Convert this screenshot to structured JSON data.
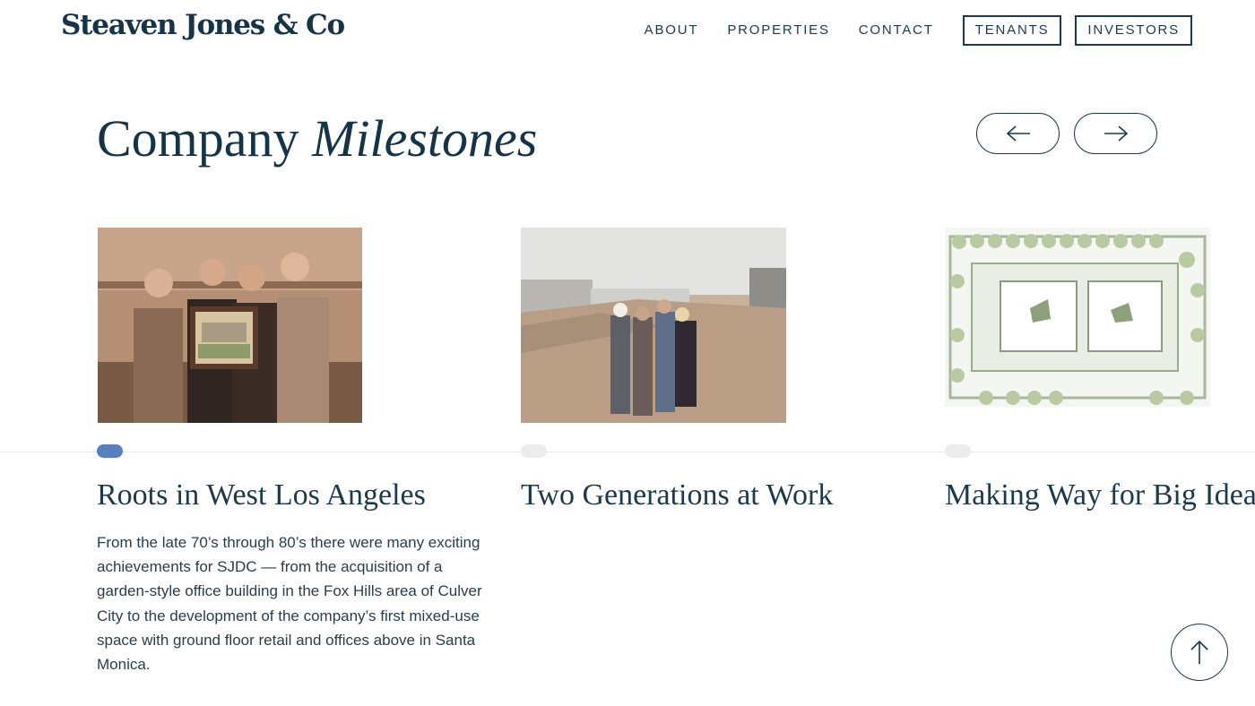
{
  "header": {
    "logo": "Steaven Jones & Co",
    "nav": {
      "about": "ABOUT",
      "properties": "PROPERTIES",
      "contact": "CONTACT"
    },
    "buttons": {
      "tenants": "TENANTS",
      "investors": "INVESTORS"
    }
  },
  "section": {
    "title_plain": "Company",
    "title_italic": "Milestones",
    "prev_icon": "arrow-left-icon",
    "next_icon": "arrow-right-icon"
  },
  "milestones": [
    {
      "title": "Roots in West Los Angeles",
      "active": true,
      "image": "sepia photo of four men in suits holding a framed building rendering",
      "description": "From the late 70’s through 80’s there were many exciting achievements for SJDC — from the acquisition of a garden-style office building in the Fox Hills area of Culver City to the development of the company’s first mixed-use space with ground floor retail and offices above in Santa Monica."
    },
    {
      "title": "Two Generations at Work",
      "active": false,
      "image": "photo of groundbreaking ceremony with people holding a shovel at a dirt site"
    },
    {
      "title": "Making Way for Big Ideas",
      "active": false,
      "image": "landscape site plan drawing with trees around a building footprint"
    }
  ],
  "scroll_top_icon": "arrow-up-icon",
  "colors": {
    "navy": "#163447",
    "accent_blue": "#5a7fbf",
    "dot_inactive": "#ececec"
  }
}
